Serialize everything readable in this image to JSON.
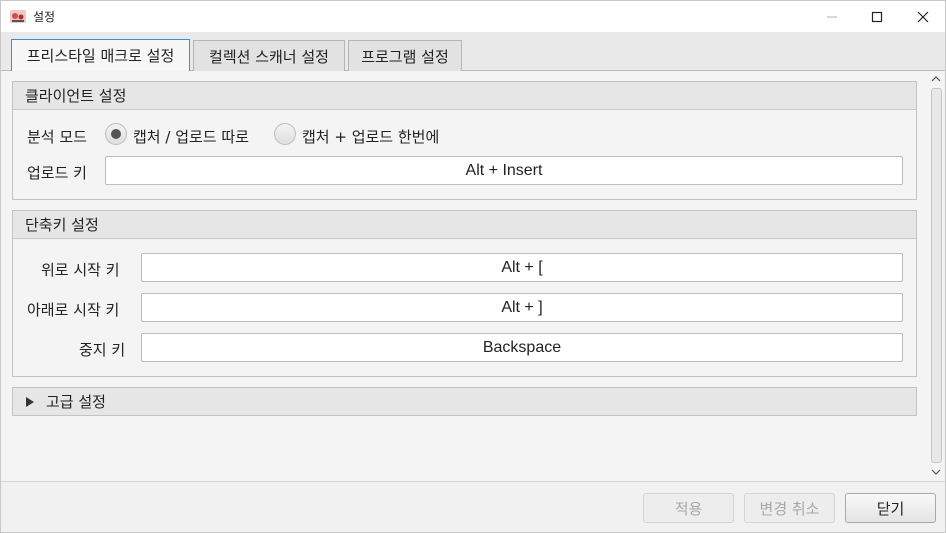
{
  "window": {
    "title": "설정"
  },
  "tabs": [
    {
      "label": "프리스타일 매크로 설정",
      "active": true
    },
    {
      "label": "컬렉션 스캐너 설정",
      "active": false
    },
    {
      "label": "프로그램 설정",
      "active": false
    }
  ],
  "client_section": {
    "header": "클라이언트 설정",
    "analysis_mode_label": "분석 모드",
    "radio_options": [
      {
        "label": "캡처 / 업로드 따로",
        "selected": true
      },
      {
        "label": "캡처 + 업로드 한번에",
        "selected": false
      }
    ],
    "upload_key_label": "업로드 키",
    "upload_key_value": "Alt + Insert"
  },
  "hotkey_section": {
    "header": "단축키 설정",
    "up_start_label": "위로 시작 키",
    "up_start_value": "Alt + [",
    "down_start_label": "아래로 시작 키",
    "down_start_value": "Alt + ]",
    "stop_label": "중지 키",
    "stop_value": "Backspace"
  },
  "advanced_section": {
    "header": "고급 설정",
    "expanded": false
  },
  "buttons": {
    "apply": "적용",
    "cancel_changes": "변경 취소",
    "close": "닫기"
  }
}
